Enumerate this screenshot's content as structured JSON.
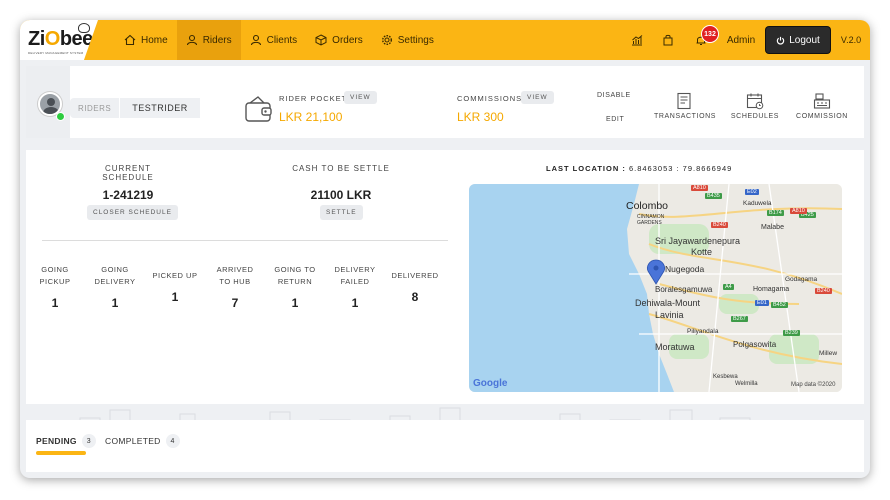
{
  "app": {
    "logo_text_a": "Zi",
    "logo_text_b": "O",
    "logo_text_c": "bee",
    "logo_subtitle": "DELIVERY MANAGEMENT SYSTEM",
    "version": "V.2.0"
  },
  "nav": {
    "items": [
      {
        "label": "Home",
        "icon": "home-icon"
      },
      {
        "label": "Riders",
        "icon": "user-icon"
      },
      {
        "label": "Clients",
        "icon": "user-icon"
      },
      {
        "label": "Orders",
        "icon": "box-icon"
      },
      {
        "label": "Settings",
        "icon": "gear-icon"
      }
    ],
    "notification_count": "132",
    "user_label": "Admin",
    "logout_label": "Logout"
  },
  "rider": {
    "section_label": "RIDERS",
    "name": "TESTRIDER",
    "pocket_label": "RIDER POCKET",
    "pocket_view": "VIEW",
    "pocket_amount": "LKR 21,100",
    "commissions_label": "COMMISSIONS",
    "commissions_view": "VIEW",
    "commissions_amount": "LKR 300",
    "disable_label": "DISABLE",
    "edit_label": "EDIT",
    "actions": [
      {
        "label": "TRANSACTIONS",
        "icon": "receipt-icon"
      },
      {
        "label": "SCHEDULES",
        "icon": "calendar-icon"
      },
      {
        "label": "COMMISSION",
        "icon": "cash-register-icon"
      }
    ]
  },
  "schedule": {
    "current_label": "CURRENT SCHEDULE",
    "current_value": "1-241219",
    "closer_button": "CLOSER SCHEDULE",
    "cash_label": "CASH TO BE SETTLE",
    "cash_value": "21100 LKR",
    "settle_button": "SETTLE"
  },
  "stats": [
    {
      "line1": "GOING",
      "line2": "PICKUP",
      "value": "1"
    },
    {
      "line1": "GOING",
      "line2": "DELIVERY",
      "value": "1"
    },
    {
      "line1": "PICKED UP",
      "line2": "",
      "value": "1"
    },
    {
      "line1": "ARRIVED",
      "line2": "TO HUB",
      "value": "7"
    },
    {
      "line1": "GOING TO",
      "line2": "RETURN",
      "value": "1"
    },
    {
      "line1": "DELIVERY",
      "line2": "FAILED",
      "value": "1"
    },
    {
      "line1": "DELIVERED",
      "line2": "",
      "value": "8"
    }
  ],
  "location": {
    "label": "LAST LOCATION :",
    "coords": "6.8463053 : 79.8666949"
  },
  "map": {
    "places": {
      "colombo": "Colombo",
      "cinnamon": "CINNAMON\nGARDENS",
      "sri_j": "Sri Jayawardenepura",
      "kotte": "Kotte",
      "kaduwela": "Kaduwela",
      "malabe": "Malabe",
      "nugegoda": "Nugegoda",
      "boralesgamuwa": "Boralesgamuwa",
      "dehiwala": "Dehiwala-Mount",
      "lavinia": "Lavinia",
      "homagama": "Homagama",
      "godagama": "Godagama",
      "piliyandala": "Piliyandala",
      "moratuwa": "Moratuwa",
      "polgasowita": "Polgasowita",
      "millew": "Millew",
      "welmilla": "Welmilla",
      "kesbewa": "Kesbewa"
    },
    "roads": [
      "A810",
      "B435",
      "E02",
      "B174",
      "B240",
      "A4",
      "E01",
      "B452",
      "B267",
      "B239",
      "B425",
      "A810",
      "B240"
    ],
    "google": "Google",
    "attribution": "Map data ©2020"
  },
  "tabs": [
    {
      "label": "PENDING",
      "count": "3"
    },
    {
      "label": "COMPLETED",
      "count": "4"
    }
  ]
}
